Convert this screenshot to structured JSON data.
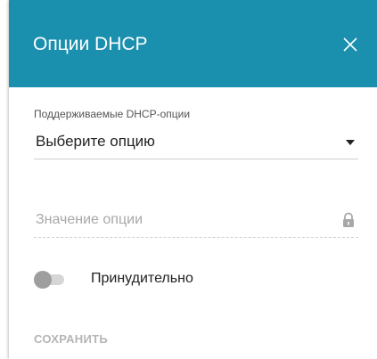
{
  "dialog": {
    "title": "Опции DHCP",
    "close_icon": "close-icon"
  },
  "option_select": {
    "label": "Поддерживаемые DHCP-опции",
    "value": "Выберите опцию",
    "icon": "chevron-down-icon"
  },
  "option_value": {
    "placeholder": "Значение опции",
    "value": "",
    "icon": "lock-icon"
  },
  "force_toggle": {
    "label": "Принудительно",
    "checked": false
  },
  "actions": {
    "save_label": "СОХРАНИТЬ",
    "save_enabled": false
  },
  "colors": {
    "header": "#1a8fae",
    "header_text": "#ffffff",
    "disabled_text": "#b5b5b5"
  }
}
